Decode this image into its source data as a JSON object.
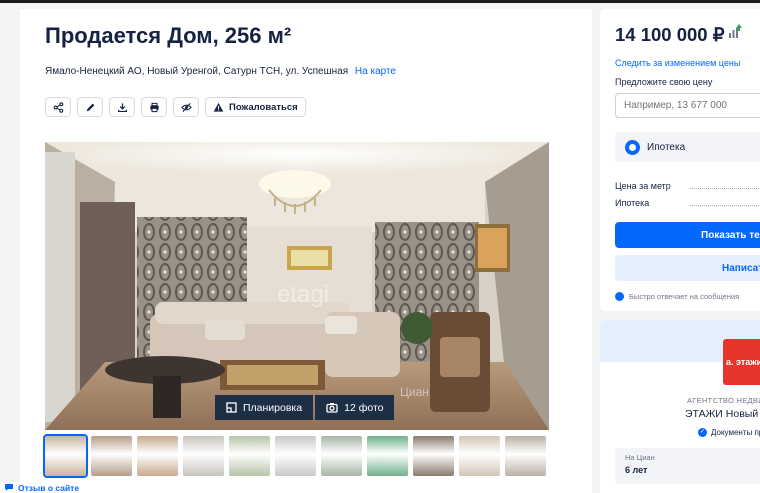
{
  "listing": {
    "title": "Продается Дом, 256 м²",
    "address": "Ямало-Ненецкий АО, Новый Уренгой, Сатурн ТСН, ул. Успешная",
    "map_link": "На карте"
  },
  "actions": {
    "icons": [
      "share-icon",
      "edit-icon",
      "download-icon",
      "print-icon",
      "hide-icon",
      "warning-icon"
    ],
    "report_label": "Пожаловаться"
  },
  "gallery": {
    "watermark": "etagi",
    "watermark2": "Циан",
    "plan_label": "Планировка",
    "photos_label": "12 фото",
    "thumb_colors": [
      "#c8b49c",
      "#b59c88",
      "#c9a98f",
      "#c7c3bd",
      "#b6c4a8",
      "#c9c9c7",
      "#a7b6a5",
      "#6fb08a",
      "#8a7b6e",
      "#d2c6b4",
      "#b9b1a4"
    ]
  },
  "feedback": {
    "label": "Отзыв о сайте"
  },
  "sidebar": {
    "price": "14 100 000 ₽",
    "follow_link": "Следить за изменением цены",
    "offer_label": "Предложите свою цену",
    "offer_placeholder": "Например, 13 677 000",
    "mortgage_label": "Ипотека",
    "rows": [
      "Цена за метр",
      "Ипотека"
    ],
    "show_phone": "Показать тел",
    "write": "Написат",
    "reply_note": "Быстро отвечает на сообщения"
  },
  "agency": {
    "logo_text": "a. этажи",
    "type": "АГЕНТСТВО НЕДВИ",
    "name": "ЭТАЖИ Новый",
    "docs": "Документы пр",
    "on_cian_label": "На Циан",
    "on_cian_value": "6 лет"
  },
  "colors": {
    "accent": "#0468ff",
    "text": "#152242",
    "brand_red": "#e8352c",
    "badge_bg": "#112842"
  }
}
